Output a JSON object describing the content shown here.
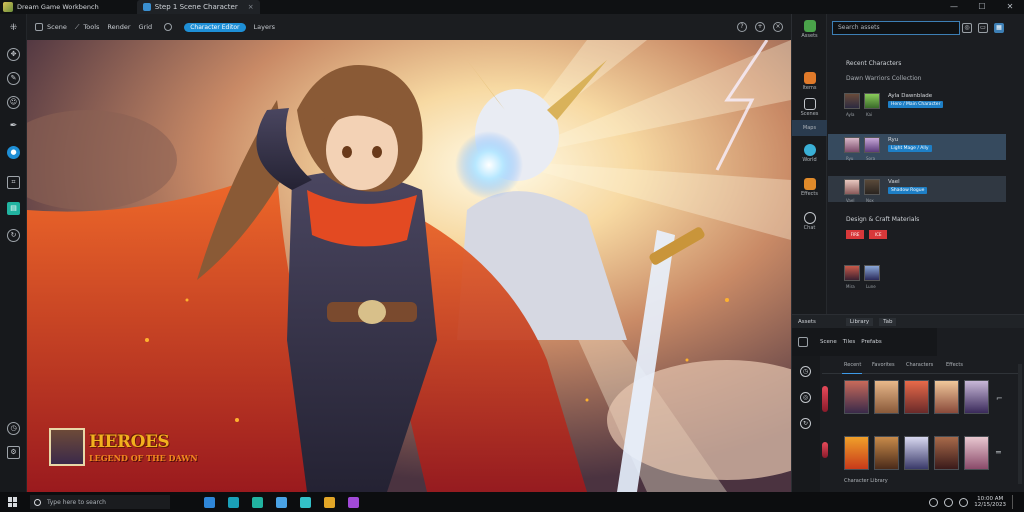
{
  "window": {
    "title": "Dream Game Workbench",
    "tab_title": "Step 1 Scene Character",
    "tab_close": "×",
    "controls": [
      "—",
      "☐",
      "✕"
    ]
  },
  "toolbar": {
    "items": [
      "Scene",
      "Tools",
      "Render",
      "Grid"
    ],
    "active_chip": "Character Editor",
    "after_chip": "Layers"
  },
  "left_rail": {
    "icons": [
      "hierarchy-icon",
      "move-icon",
      "brush-icon",
      "face-icon",
      "pen-icon",
      "info-icon",
      "crop-icon",
      "layers-icon",
      "refresh-icon",
      "history-icon",
      "settings-icon"
    ]
  },
  "canvas": {
    "badge_title": "HEROES",
    "badge_subtitle": "LEGEND OF THE DAWN"
  },
  "right_panel": {
    "search_placeholder": "Search assets",
    "tabs": [
      "Assets",
      "Items",
      "Scenes",
      "Maps",
      "World",
      "Effects",
      "Chat"
    ],
    "section1_title": "Recent Characters",
    "section1_sub": "Dawn Warriors Collection",
    "rows": [
      {
        "name": "Ayla Dawnblade",
        "tag": "Hero / Main Character",
        "caps": [
          "Ayla",
          "Kai"
        ]
      },
      {
        "name": "Ryu",
        "tag": "Light Mage / Ally",
        "caps": [
          "Ryu",
          "Sora"
        ]
      },
      {
        "name": "Vael",
        "tag": "Shadow Rogue",
        "caps": [
          "Vael",
          "Nox"
        ]
      }
    ],
    "section2_title": "Design & Craft Materials",
    "chips": [
      "FIRE",
      "ICE"
    ],
    "row4_caps": [
      "Mira",
      "Lune"
    ]
  },
  "bottom_panel": {
    "header": [
      "Assets",
      "Library",
      "Tab"
    ],
    "sub": [
      "Scene",
      "Tiles",
      "Prefabs"
    ],
    "grid_cols": [
      "Recent",
      "Favorites",
      "Characters",
      "Effects"
    ],
    "footer": "Character Library",
    "rail_icons": [
      "clock-icon",
      "target-icon",
      "rotate-icon"
    ]
  },
  "taskbar": {
    "search_text": "Type here to search",
    "apps": [
      "#2f86d8",
      "#1aa0b8",
      "#21b3a0",
      "#4aa3e6",
      "#33c0c8",
      "#e2a627",
      "#a24ad8"
    ],
    "clock_time": "10:00 AM",
    "clock_date": "12/15/2023"
  }
}
